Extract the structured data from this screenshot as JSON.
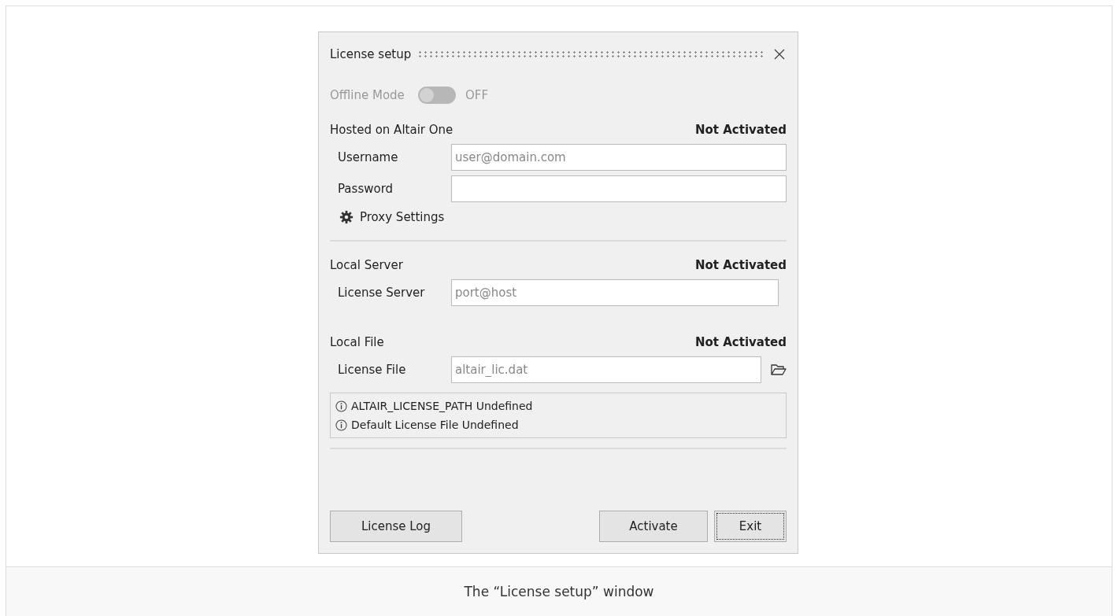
{
  "window": {
    "title": "License setup"
  },
  "offline_mode": {
    "label": "Offline Mode",
    "on": false,
    "disabled": true,
    "state_text": "OFF"
  },
  "sections": [
    {
      "kind": "hosted",
      "title": "Hosted on Altair One",
      "status": "Not Activated",
      "fields": [
        {
          "label": "Username",
          "placeholder": "user@domain.com"
        },
        {
          "label": "Password"
        }
      ],
      "link": "Proxy Settings"
    },
    {
      "kind": "server",
      "title": "Local Server",
      "status": "Not Activated",
      "fields": [
        {
          "label": "License Server",
          "placeholder": "port@host"
        }
      ]
    },
    {
      "kind": "file",
      "title": "Local File",
      "status": "Not Activated",
      "fields": [
        {
          "label": "License File",
          "placeholder": "altair_lic.dat"
        }
      ],
      "messages": [
        "ALTAIR_LICENSE_PATH Undefined",
        "Default License File Undefined"
      ]
    }
  ],
  "buttons": [
    {
      "label": "License Log",
      "focused": false
    },
    {
      "label": "Activate",
      "focused": false
    },
    {
      "label": "Exit",
      "focused": true
    }
  ],
  "caption": "The “License setup” window"
}
